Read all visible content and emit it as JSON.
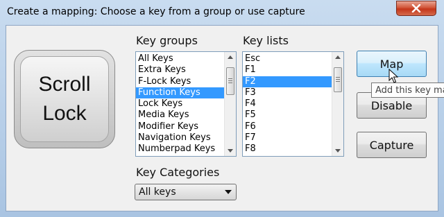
{
  "window": {
    "title": "Create a mapping: Choose a key from a group or use capture"
  },
  "big_key": {
    "line1": "Scroll",
    "line2": "Lock"
  },
  "key_groups": {
    "label": "Key groups",
    "items": [
      "All Keys",
      "Extra Keys",
      "F-Lock Keys",
      "Function Keys",
      "Lock Keys",
      "Media Keys",
      "Modifier Keys",
      "Navigation Keys",
      "Numberpad Keys"
    ],
    "selected": "Function Keys"
  },
  "key_lists": {
    "label": "Key lists",
    "items": [
      "Esc",
      "F1",
      "F2",
      "F3",
      "F4",
      "F5",
      "F6",
      "F7",
      "F8"
    ],
    "selected": "F2"
  },
  "buttons": {
    "map": "Map",
    "disable": "Disable",
    "capture": "Capture"
  },
  "tooltip": {
    "text": "Add this key ma"
  },
  "key_categories": {
    "label": "Key Categories",
    "value": "All keys"
  },
  "icons": {
    "close": "close-icon",
    "cursor": "mouse-pointer-icon"
  },
  "colors": {
    "selection": "#3399ff",
    "close_button": "#c4361a",
    "hot_button": "#bee6fd"
  }
}
